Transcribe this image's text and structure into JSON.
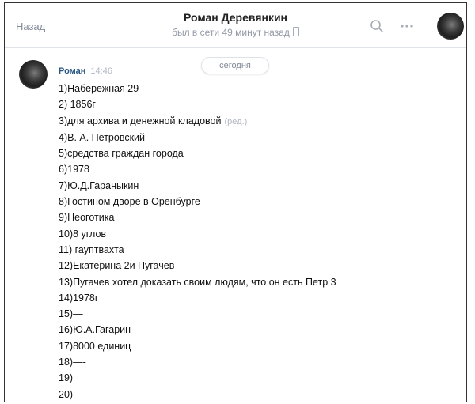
{
  "header": {
    "back_label": "Назад",
    "contact_name": "Роман Деревянкин",
    "status": "был в сети 49 минут назад"
  },
  "icons": {
    "search": "search-icon",
    "more": "more-icon",
    "mobile": "mobile-icon"
  },
  "chat": {
    "date_divider": "сегодня",
    "message": {
      "author": "Роман",
      "time": "14:46",
      "edited_marker": "(ред.)",
      "lines": [
        "1)Набережная 29",
        "2) 1856г",
        "3)для архива и денежной кладовой",
        "4)В. А. Петровский",
        "5)средства граждан города",
        "6)1978",
        "7)Ю.Д.Гараныкин",
        "8)Гостином дворе в Оренбурге",
        "9)Неоготика",
        "10)8 углов",
        "11) гауптвахта",
        "12)Екатерина 2и Пугачев",
        "13)Пугачев хотел доказать своим людям, что он есть Петр 3",
        "14)1978г",
        "15)—",
        "16)Ю.А.Гагарин",
        "17)8000 единиц",
        "18)—-",
        "19)",
        "20)"
      ]
    }
  },
  "colors": {
    "link": "#2a5885",
    "muted": "#828a99",
    "divider": "#dfe3e8"
  }
}
